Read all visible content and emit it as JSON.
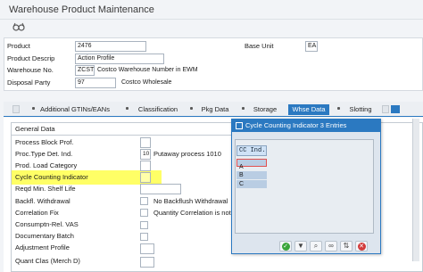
{
  "window": {
    "title": "Warehouse Product Maintenance"
  },
  "header": {
    "product_label": "Product",
    "product_value": "2476",
    "product_descrip_label": "Product Descrip",
    "product_descrip_value": "Action Profile",
    "warehouse_label": "Warehouse No.",
    "warehouse_code": "ZCST",
    "warehouse_desc": "Costco Warehouse Number in EWM",
    "disposal_label": "Disposal Party",
    "disposal_code": "97",
    "disposal_desc": "Costco Wholesale",
    "base_unit_label": "Base Unit",
    "base_unit_value": "EA"
  },
  "tabs": [
    {
      "label": "Additional GTINs/EANs"
    },
    {
      "label": "Classification"
    },
    {
      "label": "Pkg Data"
    },
    {
      "label": "Storage"
    },
    {
      "label": "Whse Data",
      "active": true
    },
    {
      "label": "Slotting"
    }
  ],
  "general": {
    "group_title": "General Data",
    "rows": [
      {
        "label": "Process Block Prof."
      },
      {
        "label": "Proc.Type Det. Ind.",
        "value": "10",
        "desc": "Putaway process 1010"
      },
      {
        "label": "Prod. Load Category"
      },
      {
        "label": "Cycle Counting Indicator"
      },
      {
        "label": "Reqd Min. Shelf Life"
      },
      {
        "label": "Backfl. Withdrawal",
        "desc": "No Backflush Withdrawal"
      },
      {
        "label": "Correlation Fix",
        "desc": "Quantity Correlation is not"
      },
      {
        "label": "Consumptn-Rel. VAS"
      },
      {
        "label": "Documentary Batch"
      },
      {
        "label": "Adjustment Profile"
      },
      {
        "label": "Quant Clas (Merch D)"
      }
    ]
  },
  "popup": {
    "title": "Cycle Counting Indicator 3 Entries",
    "column_header": "CC Ind.",
    "entries": [
      "A",
      "B",
      "C"
    ]
  },
  "colors": {
    "accent": "#2b79c1",
    "highlight": "#ffff66",
    "popup_bg": "#dde5ee"
  }
}
